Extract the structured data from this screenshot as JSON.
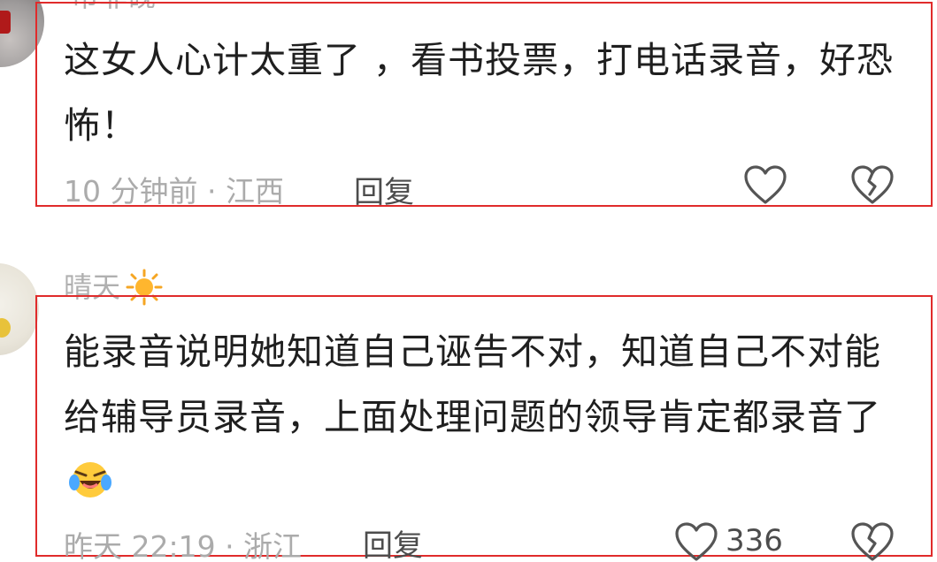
{
  "comments": [
    {
      "username": "市菲砚",
      "text": "这女人心计太重了 ，看书投票，打电话录音，好恐怖！",
      "meta": "10 分钟前 · 江西",
      "reply_label": "回复",
      "like_count": ""
    },
    {
      "username": "晴天",
      "username_emoji": "sun-icon",
      "text": "能录音说明她知道自己诬告不对，知道自己不对能给辅导员录音，上面处理问题的领导肯定都录音了",
      "text_emoji": "laughing-crying-emoji-icon",
      "meta": "昨天 22:19 · 浙江",
      "reply_label": "回复",
      "like_count": "336"
    }
  ],
  "colors": {
    "highlight_border": "#e02b2b",
    "meta_text": "#ababab",
    "body_text": "#1f1f1f"
  }
}
